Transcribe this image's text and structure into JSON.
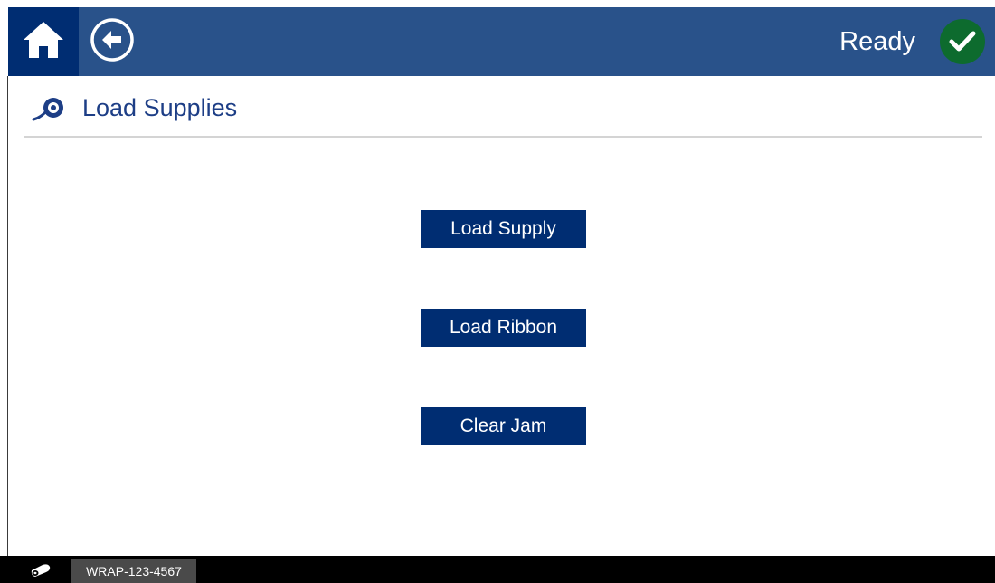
{
  "header": {
    "home_icon": "home-icon",
    "back_icon": "back-arrow-circle-icon",
    "status_text": "Ready",
    "status_icon": "check-circle-icon",
    "status_color": "#0d6b2e",
    "bar_color": "#29528a",
    "home_bg_color": "#002d72"
  },
  "page": {
    "icon": "supply-roll-icon",
    "title": "Load Supplies"
  },
  "actions": [
    {
      "label": "Load Supply"
    },
    {
      "label": "Load Ribbon"
    },
    {
      "label": "Clear Jam"
    }
  ],
  "footer": {
    "icon": "supply-roll-icon",
    "supply_id": "WRAP-123-4567"
  }
}
